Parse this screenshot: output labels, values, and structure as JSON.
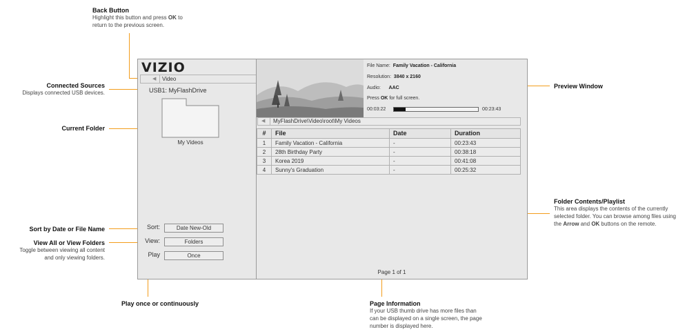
{
  "callouts": {
    "back_button": {
      "title": "Back Button",
      "desc1": "Highlight this button and press",
      "desc_ok": "OK",
      "desc2": "to",
      "desc3": "return to the previous screen."
    },
    "connected_sources": {
      "title": "Connected Sources",
      "desc": "Displays connected USB devices."
    },
    "current_folder": {
      "title": "Current Folder"
    },
    "sort": {
      "title": "Sort by Date or File Name"
    },
    "view": {
      "title": "View All or View Folders",
      "desc1": "Toggle between viewing all content",
      "desc2": "and only viewing folders."
    },
    "play": {
      "title": "Play once or continuously"
    },
    "preview": {
      "title": "Preview Window"
    },
    "folder_contents": {
      "title": "Folder Contents/Playlist",
      "desc1": "This area displays the contents of the currently",
      "desc2": "selected folder. You can browse among files using",
      "desc3_the": "the",
      "desc3_arrow": "Arrow",
      "desc3_and": "and",
      "desc3_ok": "OK",
      "desc3_end": "buttons on the remote."
    },
    "page_info": {
      "title": "Page Information",
      "desc1": "If your USB thumb drive has more files than",
      "desc2": "can be displayed on a single screen, the page",
      "desc3": "number is displayed here."
    }
  },
  "screen": {
    "logo": "VIZIO",
    "back_label": "Video",
    "usb": "USB1: MyFlashDrive",
    "folder_name": "My Videos",
    "controls": {
      "sort_label": "Sort:",
      "sort_value": "Date New-Old",
      "view_label": "View:",
      "view_value": "Folders",
      "play_label": "Play",
      "play_value": "Once"
    },
    "preview": {
      "file_name_label": "File Name:",
      "file_name": "Family Vacation - California",
      "resolution_label": "Resolution:",
      "resolution": "3840 x 2160",
      "audio_label": "Audio:",
      "audio": "AAC",
      "fullscreen_press": "Press",
      "fullscreen_ok": "OK",
      "fullscreen_rest": "for full screen.",
      "time_elapsed": "00:03:22",
      "time_total": "00:23:43",
      "progress_fraction": 0.14
    },
    "path": "MyFlashDrive\\Video\\root\\My Videos",
    "table": {
      "headers": [
        "#",
        "File",
        "Date",
        "Duration"
      ],
      "rows": [
        [
          "1",
          "Family Vacation - California",
          "-",
          "00:23:43"
        ],
        [
          "2",
          "28th Birthday Party",
          "-",
          "00:38:18"
        ],
        [
          "3",
          "Korea 2019",
          "-",
          "00:41:08"
        ],
        [
          "4",
          "Sunny's Graduation",
          "-",
          "00:25:32"
        ]
      ]
    },
    "page_info": "Page 1 of 1"
  },
  "colors": {
    "callout_line": "#f39c1a",
    "screen_bg": "#e8e8e8"
  }
}
